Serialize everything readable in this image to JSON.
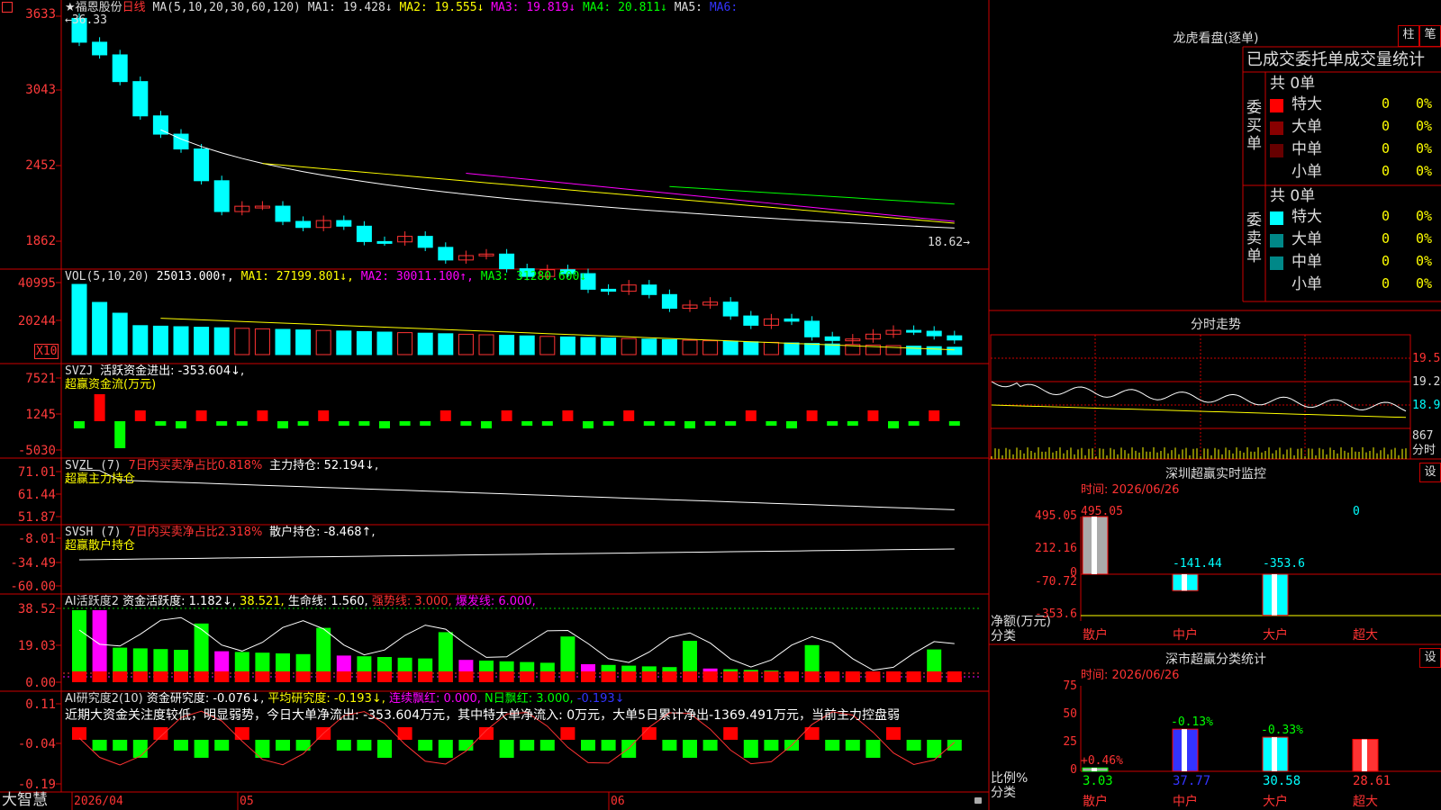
{
  "stock": {
    "name": "★福恩股份",
    "period": "日线",
    "star": "★"
  },
  "ma_line": {
    "label": "MA(5,10,20,30,60,120)",
    "ma1": "MA1: 19.428↓",
    "ma2": "MA2: 19.555↓",
    "ma3": "MA3: 19.819↓",
    "ma4": "MA4: 20.811↓",
    "ma5": "MA5:",
    "ma6": "MA6:"
  },
  "price_axis": [
    "3633",
    "3043",
    "2452",
    "1862"
  ],
  "price_marks": {
    "high": "36.33",
    "low": "18.62"
  },
  "vol": {
    "label": "VOL(5,10,20)",
    "value": "25013.000↑,",
    "ma1": "MA1: 27199.801↓,",
    "ma2": "MA2: 30011.100↑,",
    "ma3": "MA3: 31280.600↓",
    "axis": [
      "40995",
      "20244"
    ],
    "unit": "X10"
  },
  "svzj": {
    "label": "SVZJ",
    "desc": "活跃资金进出: -353.604↓,",
    "sub": "超赢资金流(万元)",
    "axis": [
      "7521",
      "1245",
      "-5030"
    ]
  },
  "svzl": {
    "label": "SVZL (7)",
    "ratio": "7日内买卖净占比0.818%",
    "hold": "主力持仓: 52.194↓,",
    "sub": "超赢主力持仓",
    "axis": [
      "71.01",
      "61.44",
      "51.87"
    ]
  },
  "svsh": {
    "label": "SVSH (7)",
    "ratio": "7日内买卖净占比2.318%",
    "hold": "散户持仓: -8.468↑,",
    "sub": "超赢散户持仓",
    "axis": [
      "-8.01",
      "-34.49",
      "-60.00"
    ]
  },
  "ai_active": {
    "label": "AI活跃度2",
    "v1": "资金活跃度: 1.182↓,",
    "v2": "38.521,",
    "v3": "生命线: 1.560,",
    "v4": "强势线: 3.000,",
    "v5": "爆发线: 6.000,",
    "axis": [
      "38.52",
      "19.03",
      "0.00"
    ]
  },
  "ai_research": {
    "label": "AI研究度2(10)",
    "v1": "资金研究度: -0.076↓,",
    "v2": "平均研究度: -0.193↓,",
    "v3": "连续飘红: 0.000,",
    "v4": "N日飘红: 3.000,",
    "v5": "-0.193↓",
    "note": "近期大资金关注度较低，明显弱势，今日大单净流出: -353.604万元，其中特大单净流入: 0万元，大单5日累计净出-1369.491万元，当前主力控盘弱",
    "axis": [
      "0.11",
      "-0.04",
      "-0.19"
    ]
  },
  "bottom": {
    "brand": "大智慧",
    "dates": [
      "2026/04",
      "05",
      "06"
    ]
  },
  "longhu": {
    "title": "龙虎看盘(逐单)",
    "btn1": "柱",
    "btn2": "笔",
    "tabs": [
      "已成交",
      "委托单",
      "成交量统计"
    ],
    "buy": {
      "side": "委买单",
      "total": "共 0单",
      "rows": [
        {
          "name": "特大",
          "v": "0",
          "p": "0%"
        },
        {
          "name": "大单",
          "v": "0",
          "p": "0%"
        },
        {
          "name": "中单",
          "v": "0",
          "p": "0%"
        },
        {
          "name": "小单",
          "v": "0",
          "p": "0%"
        }
      ]
    },
    "sell": {
      "side": "委卖单",
      "total": "共 0单",
      "rows": [
        {
          "name": "特大",
          "v": "0",
          "p": "0%"
        },
        {
          "name": "大单",
          "v": "0",
          "p": "0%"
        },
        {
          "name": "中单",
          "v": "0",
          "p": "0%"
        },
        {
          "name": "小单",
          "v": "0",
          "p": "0%"
        }
      ]
    }
  },
  "fenshi": {
    "title": "分时走势",
    "axis": [
      "19.52",
      "19.24",
      "18.95"
    ],
    "vol_axis": "867",
    "vol_label": "分时"
  },
  "monitor": {
    "title": "深圳超赢实时监控",
    "btn": "设",
    "time": "时间: 2026/06/26",
    "axis": [
      "495.05",
      "212.16",
      "0",
      "-70.72",
      "-353.6"
    ],
    "ylabel": "净额(万元)",
    "xlabel": "分类",
    "values": [
      {
        "cat": "散户",
        "v": "495.05"
      },
      {
        "cat": "中户",
        "v": "-141.44"
      },
      {
        "cat": "大户",
        "v": "-353.6"
      },
      {
        "cat": "超大",
        "v": "0"
      }
    ]
  },
  "classify": {
    "title": "深市超赢分类统计",
    "btn": "设",
    "time": "时间: 2026/06/26",
    "axis": [
      "75",
      "50",
      "25",
      "0"
    ],
    "ylabel": "比例%",
    "xlabel": "分类",
    "values": [
      {
        "cat": "散户",
        "v": "3.03",
        "d": "+0.46%"
      },
      {
        "cat": "中户",
        "v": "37.77",
        "d": "-0.13%"
      },
      {
        "cat": "大户",
        "v": "30.58",
        "d": "-0.33%"
      },
      {
        "cat": "超大",
        "v": "28.61",
        "d": ""
      }
    ]
  }
}
